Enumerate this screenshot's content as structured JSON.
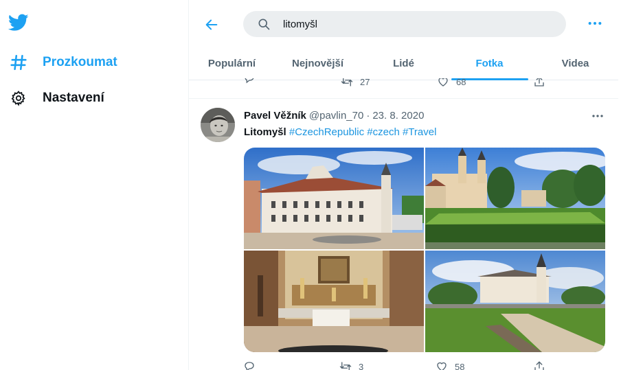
{
  "sidebar": {
    "items": [
      {
        "label": "Prozkoumat",
        "icon": "hashtag-icon"
      },
      {
        "label": "Nastavení",
        "icon": "gear-icon"
      }
    ]
  },
  "header": {
    "search_value": "litomyšl"
  },
  "tabs": [
    "Populární",
    "Nejnovější",
    "Lidé",
    "Fotka",
    "Videa"
  ],
  "active_tab": "Fotka",
  "prev_tweet_actions": {
    "retweets": "27",
    "likes": "68"
  },
  "tweet": {
    "name": "Pavel Věžník",
    "handle": "@pavlin_70",
    "separator": "·",
    "date": "23. 8. 2020",
    "text_bold": "Litomyšl",
    "hashtags": [
      "#CzechRepublic",
      "#czech",
      "#Travel"
    ],
    "retweets": "3",
    "likes": "58"
  },
  "colors": {
    "accent": "#1da1f2",
    "hashtag": "#1b95e0",
    "muted": "#536471"
  }
}
